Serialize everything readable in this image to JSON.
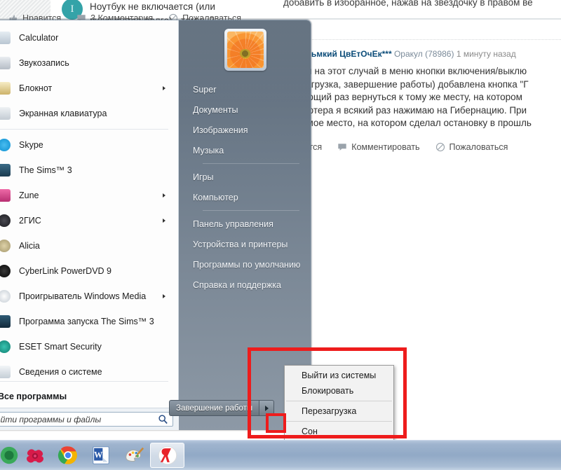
{
  "browser_page": {
    "question_title": "Ноутбук не включается (или включается долго) - темный",
    "avatar_letter": "I",
    "top_text": "добавить в изборанное, нажав на звездочку в правом ве",
    "top_actions": [
      {
        "label": "Нравится",
        "icon": "thumbs-up-icon"
      },
      {
        "label": "3 Комментария",
        "icon": "comment-icon"
      },
      {
        "label": "Пожаловаться",
        "icon": "report-icon"
      }
    ],
    "answer": {
      "nick": "еньмкий ЦвЕтОчЕк***",
      "rank": "Оракул (78986)",
      "time": "1 минуту назад",
      "lines": [
        "ня на этот случай в меню кнопки включения/выклю",
        "загрузка, завершение работы) добавлена кнопка \"Г",
        "ующий раз вернуться к тому же месту, на котором",
        "ьютера я всякий раз нажимаю на Гибернацию. При",
        "имое место, на котором сделал остановку в прошль"
      ],
      "actions": [
        {
          "label": "авится",
          "icon": "thumbs-up-icon"
        },
        {
          "label": "Комментировать",
          "icon": "comment-icon"
        },
        {
          "label": "Пожаловаться",
          "icon": "report-icon"
        }
      ]
    }
  },
  "start_menu": {
    "programs": [
      {
        "label": "Calculator",
        "icon": "calculator-icon",
        "color": "#c9d4dd",
        "submenu": false
      },
      {
        "label": "Звукозапись",
        "icon": "sound-recorder-icon",
        "color": "#c8ccd2",
        "submenu": false
      },
      {
        "label": "Блокнот",
        "icon": "notepad-icon",
        "color": "#d8c58a",
        "submenu": true
      },
      {
        "label": "Экранная клавиатура",
        "icon": "on-screen-keyboard-icon",
        "color": "#cfd4d9",
        "submenu": false
      }
    ],
    "programs2": [
      {
        "label": "Skype",
        "icon": "skype-icon",
        "color": "#2aaae1",
        "submenu": false
      },
      {
        "label": "The Sims™ 3",
        "icon": "sims3-icon",
        "color": "#2b4e63",
        "submenu": false
      },
      {
        "label": "Zune",
        "icon": "zune-icon",
        "color": "#d44f8c",
        "submenu": true
      },
      {
        "label": "2ГИС",
        "icon": "2gis-icon",
        "color": "#2f2f35",
        "submenu": true
      },
      {
        "label": "Alicia",
        "icon": "alicia-icon",
        "color": "#c0b48a",
        "submenu": false
      },
      {
        "label": "CyberLink PowerDVD 9",
        "icon": "powerdvd-icon",
        "color": "#141414",
        "submenu": false
      },
      {
        "label": "Проигрыватель Windows Media",
        "icon": "windows-media-player-icon",
        "color": "#e8ecef",
        "submenu": true
      },
      {
        "label": "Программа запуска The Sims™ 3",
        "icon": "sims3-launcher-icon",
        "color": "#1f4257",
        "submenu": false
      },
      {
        "label": "ESET Smart Security",
        "icon": "eset-icon",
        "color": "#1f9e8e",
        "submenu": false
      },
      {
        "label": "Сведения о системе",
        "icon": "system-info-icon",
        "color": "#dfe4e8",
        "submenu": false
      }
    ],
    "all_programs_label": "Все программы",
    "search_placeholder": "айти программы и файлы",
    "search_value": "",
    "search_icon": "search-icon",
    "right_items_group1": [
      "Super",
      "Документы",
      "Изображения",
      "Музыка"
    ],
    "right_items_group2": [
      "Игры",
      "Компьютер"
    ],
    "right_items_group3": [
      "Панель управления",
      "Устройства и принтеры",
      "Программы по умолчанию",
      "Справка и поддержка"
    ],
    "shutdown_label": "Завершение работы",
    "shutdown_arrow_icon": "chevron-right-icon",
    "user_picture_icon": "flower-user-picture"
  },
  "power_menu": {
    "group1": [
      "Выйти из системы",
      "Блокировать"
    ],
    "group2": [
      "Перезагрузка"
    ],
    "group3": [
      "Сон"
    ]
  },
  "annotation": {
    "color": "#ee1c1c"
  },
  "taskbar": {
    "items": [
      {
        "name": "firefox-icon",
        "active": false
      },
      {
        "name": "rose-icon",
        "active": false
      },
      {
        "name": "google-chrome-icon",
        "active": false
      },
      {
        "name": "microsoft-word-icon",
        "active": false
      },
      {
        "name": "paint-icon",
        "active": false
      },
      {
        "name": "yandex-browser-icon",
        "active": true
      }
    ]
  }
}
